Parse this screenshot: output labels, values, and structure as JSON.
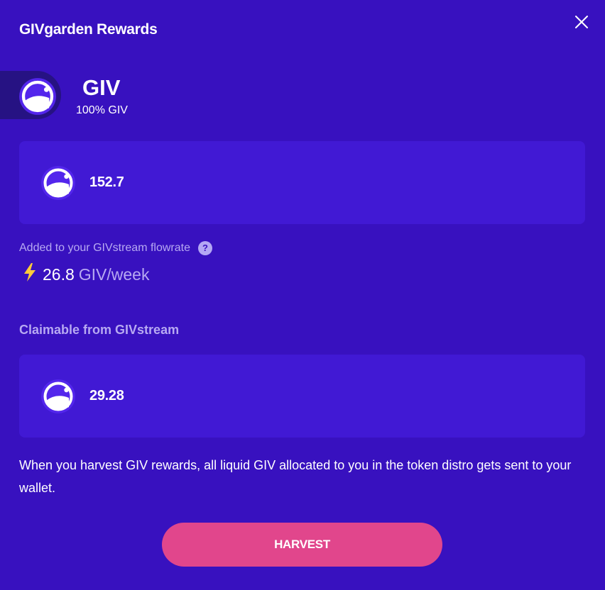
{
  "header": {
    "title": "GIVgarden Rewards"
  },
  "token": {
    "name": "GIV",
    "share": "100% GIV"
  },
  "rewards": {
    "amount": "152.7"
  },
  "flowrate": {
    "label": "Added to your GIVstream flowrate",
    "help": "?",
    "value": "26.8",
    "unit": "GIV/week"
  },
  "claimable": {
    "label": "Claimable from GIVstream",
    "amount": "29.28"
  },
  "info": {
    "text": "When you harvest GIV rewards, all liquid GIV allocated to you in the token distro gets sent to your wallet."
  },
  "actions": {
    "harvest_label": "HARVEST"
  },
  "colors": {
    "background": "#3811bf",
    "card": "#4119d4",
    "muted_text": "#b7a9f2",
    "harvest_button": "#e1468c",
    "lightning": "#ffca3a"
  }
}
